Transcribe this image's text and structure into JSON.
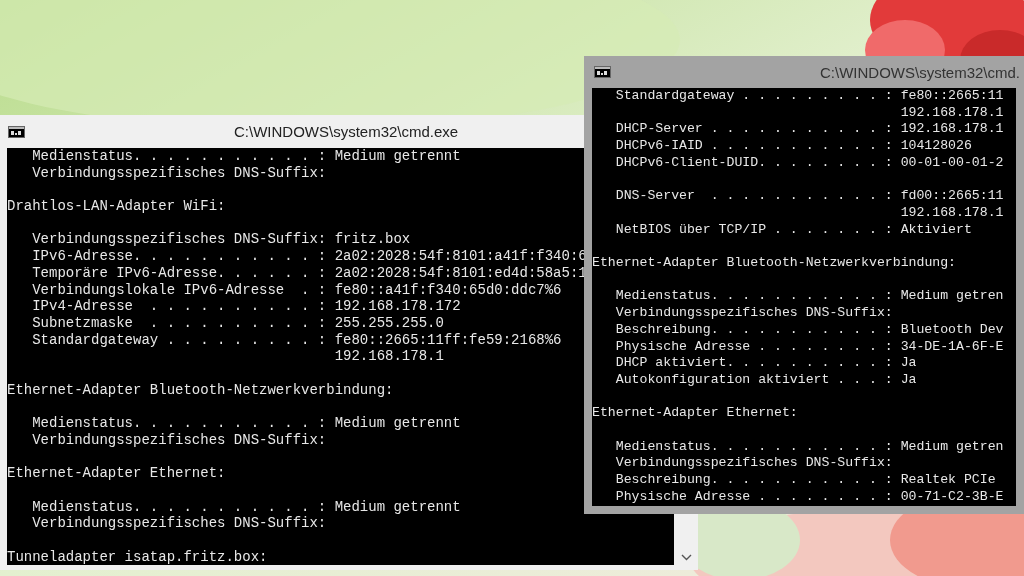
{
  "windows": [
    {
      "title": "C:\\WINDOWS\\system32\\cmd.exe",
      "lines": [
        {
          "kind": "entry",
          "text": "Medienstatus. . . . . . . . . . . : Medium getrennt"
        },
        {
          "kind": "entry",
          "text": "Verbindungsspezifisches DNS-Suffix:"
        },
        {
          "kind": "heading",
          "blank_before": true,
          "text": "Drahtlos-LAN-Adapter WiFi:"
        },
        {
          "kind": "entry",
          "blank_before": true,
          "text": "Verbindungsspezifisches DNS-Suffix: fritz.box"
        },
        {
          "kind": "entry",
          "text": "IPv6-Adresse. . . . . . . . . . . : 2a02:2028:54f:8101:a41f:f340:6"
        },
        {
          "kind": "entry",
          "text": "Temporäre IPv6-Adresse. . . . . . : 2a02:2028:54f:8101:ed4d:58a5:1"
        },
        {
          "kind": "entry",
          "text": "Verbindungslokale IPv6-Adresse  . : fe80::a41f:f340:65d0:ddc7%6"
        },
        {
          "kind": "entry",
          "text": "IPv4-Adresse  . . . . . . . . . . : 192.168.178.172"
        },
        {
          "kind": "entry",
          "text": "Subnetzmaske  . . . . . . . . . . : 255.255.255.0"
        },
        {
          "kind": "entry",
          "text": "Standardgateway . . . . . . . . . : fe80::2665:11ff:fe59:2168%6"
        },
        {
          "kind": "continuation",
          "text": "192.168.178.1"
        },
        {
          "kind": "heading",
          "blank_before": true,
          "text": "Ethernet-Adapter Bluetooth-Netzwerkverbindung:"
        },
        {
          "kind": "entry",
          "blank_before": true,
          "text": "Medienstatus. . . . . . . . . . . : Medium getrennt"
        },
        {
          "kind": "entry",
          "text": "Verbindungsspezifisches DNS-Suffix:"
        },
        {
          "kind": "heading",
          "blank_before": true,
          "text": "Ethernet-Adapter Ethernet:"
        },
        {
          "kind": "entry",
          "blank_before": true,
          "text": "Medienstatus. . . . . . . . . . . : Medium getrennt"
        },
        {
          "kind": "entry",
          "text": "Verbindungsspezifisches DNS-Suffix:"
        },
        {
          "kind": "heading",
          "blank_before": true,
          "text": "Tunneladapter isatap.fritz.box:"
        }
      ]
    },
    {
      "title": "C:\\WINDOWS\\system32\\cmd.",
      "lines": [
        {
          "kind": "entry",
          "text": "Standardgateway . . . . . . . . . : fe80::2665:11"
        },
        {
          "kind": "continuation",
          "text": "192.168.178.1"
        },
        {
          "kind": "entry",
          "text": "DHCP-Server . . . . . . . . . . . : 192.168.178.1"
        },
        {
          "kind": "entry",
          "text": "DHCPv6-IAID . . . . . . . . . . . : 104128026"
        },
        {
          "kind": "entry",
          "text": "DHCPv6-Client-DUID. . . . . . . . : 00-01-00-01-2"
        },
        {
          "kind": "entry",
          "blank_before": true,
          "text": "DNS-Server  . . . . . . . . . . . : fd00::2665:11"
        },
        {
          "kind": "continuation",
          "text": "192.168.178.1"
        },
        {
          "kind": "entry",
          "text": "NetBIOS über TCP/IP . . . . . . . : Aktiviert"
        },
        {
          "kind": "heading",
          "blank_before": true,
          "text": "Ethernet-Adapter Bluetooth-Netzwerkverbindung:"
        },
        {
          "kind": "entry",
          "blank_before": true,
          "text": "Medienstatus. . . . . . . . . . . : Medium getren"
        },
        {
          "kind": "entry",
          "text": "Verbindungsspezifisches DNS-Suffix:"
        },
        {
          "kind": "entry",
          "text": "Beschreibung. . . . . . . . . . . : Bluetooth Dev"
        },
        {
          "kind": "entry",
          "text": "Physische Adresse . . . . . . . . : 34-DE-1A-6F-E"
        },
        {
          "kind": "entry",
          "text": "DHCP aktiviert. . . . . . . . . . : Ja"
        },
        {
          "kind": "entry",
          "text": "Autokonfiguration aktiviert . . . : Ja"
        },
        {
          "kind": "heading",
          "blank_before": true,
          "text": "Ethernet-Adapter Ethernet:"
        },
        {
          "kind": "entry",
          "blank_before": true,
          "text": "Medienstatus. . . . . . . . . . . : Medium getren"
        },
        {
          "kind": "entry",
          "text": "Verbindungsspezifisches DNS-Suffix:"
        },
        {
          "kind": "entry",
          "text": "Beschreibung. . . . . . . . . . . : Realtek PCIe"
        },
        {
          "kind": "entry",
          "text": "Physische Adresse . . . . . . . . : 00-71-C2-3B-E"
        }
      ]
    }
  ]
}
